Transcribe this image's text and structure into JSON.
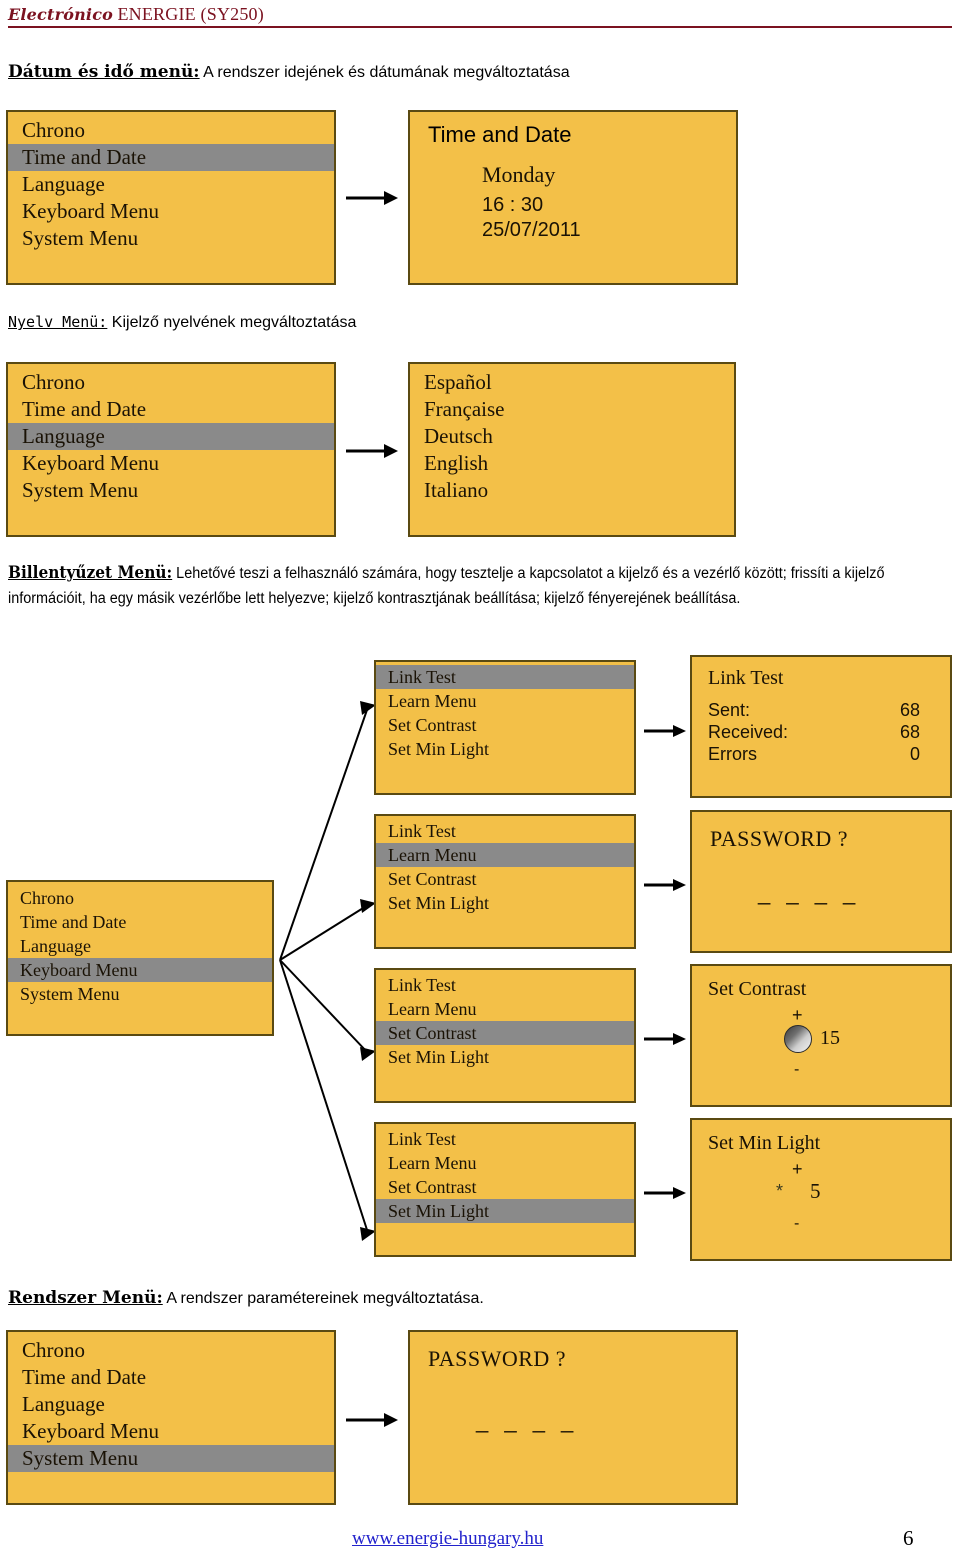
{
  "header": {
    "brand_italic": "Electrónico",
    "brand_rest": "ENERGIE (SY250)"
  },
  "sections": {
    "datetime": {
      "lead": "Dátum és idő menü:",
      "rest": " A rendszer idejének és dátumának megváltoztatása"
    },
    "language": {
      "lead_a": "Nye",
      "lead_b": "l",
      "lead_c": "v Men",
      "lead_d": "ü",
      "lead_e": ":",
      "lead_plain": "Nyelv Menü:",
      "rest": " Kijelző nyelvének megváltoztatása"
    },
    "keyboard": {
      "lead": "Billentyűzet Menü:",
      "rest": " Lehetővé teszi a felhasználó számára, hogy tesztelje a kapcsolatot a kijelző és a vezérlő között; frissíti a kijelző információit, ha egy másik vezérlőbe lett helyezve; kijelző kontrasztjának beállítása; kijelző fényerejének beállítása."
    },
    "system": {
      "lead": "Rendszer Menü:",
      "rest": "  A rendszer paramétereinek megváltoztatása."
    }
  },
  "main_menu": {
    "items": [
      "Chrono",
      "Time and Date",
      "Language",
      "Keyboard Menu",
      "System Menu"
    ]
  },
  "screens": {
    "menu_time_selected": {
      "rows": [
        "Chrono",
        "Time and Date",
        "Language",
        "Keyboard Menu",
        "System Menu"
      ],
      "selected_index": 1
    },
    "time_and_date": {
      "title": "Time and Date",
      "day": "Monday",
      "time": "16 : 30",
      "date": "25/07/2011"
    },
    "menu_language_selected": {
      "rows": [
        "Chrono",
        "Time and Date",
        "Language",
        "Keyboard Menu",
        "System Menu"
      ],
      "selected_index": 2
    },
    "language_list": {
      "rows": [
        "Español",
        "Française",
        "Deutsch",
        "English",
        "Italiano"
      ]
    },
    "menu_keyboard_selected": {
      "rows": [
        "Chrono",
        "Time and Date",
        "Language",
        "Keyboard Menu",
        "System Menu"
      ],
      "selected_index": 3
    },
    "menu_system_selected": {
      "rows": [
        "Chrono",
        "Time and Date",
        "Language",
        "Keyboard Menu",
        "System Menu"
      ],
      "selected_index": 4
    },
    "keyboard_submenu": {
      "rows": [
        "Link Test",
        "Learn Menu",
        "Set Contrast",
        "Set Min Light"
      ]
    },
    "link_test": {
      "title": "Link Test",
      "rows": [
        {
          "label": "Sent:",
          "value": "68"
        },
        {
          "label": "Received:",
          "value": "68"
        },
        {
          "label": "Errors",
          "value": "0"
        }
      ]
    },
    "password_learn": {
      "title": "PASSWORD ?",
      "dashes": "_ _ _ _"
    },
    "set_contrast": {
      "title": "Set Contrast",
      "plus": "+",
      "minus": "-",
      "value": "15"
    },
    "set_min_light": {
      "title": "Set Min Light",
      "plus": "+",
      "star": "*",
      "minus": "-",
      "value": "5"
    },
    "password_system": {
      "title": "PASSWORD ?",
      "dashes": "_ _ _ _"
    }
  },
  "footer": {
    "url": "www.energie-hungary.hu",
    "page": "6"
  },
  "colors": {
    "lcd_background": "#f3c048",
    "lcd_border": "#5a4a12",
    "highlight": "#8a8a8a",
    "brand": "#7b1220",
    "link": "#2222cc"
  }
}
